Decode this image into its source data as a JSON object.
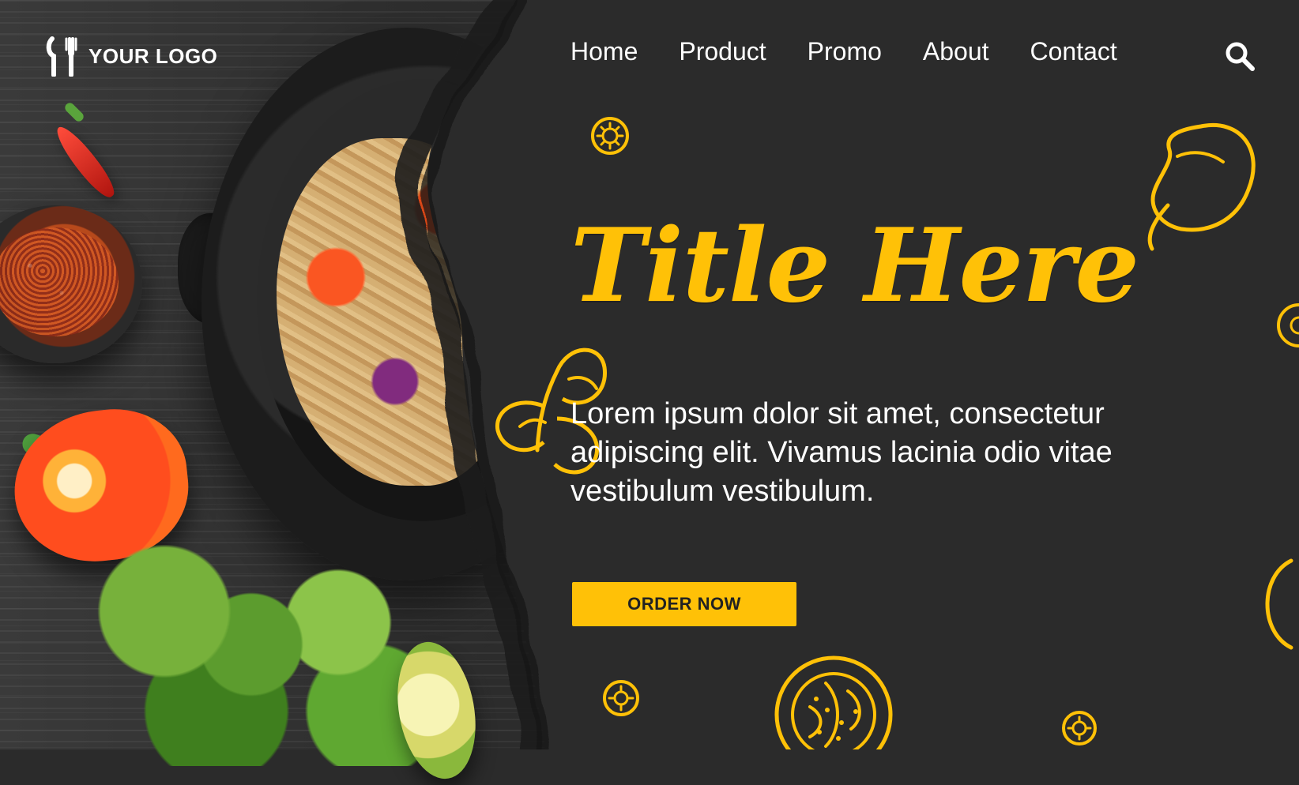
{
  "brand": {
    "logo_text": "YOUR LOGO",
    "colors": {
      "accent": "#ffc107",
      "panel": "#2b2b2b",
      "text": "#ffffff"
    }
  },
  "nav": {
    "items": [
      {
        "label": "Home"
      },
      {
        "label": "Product"
      },
      {
        "label": "Promo"
      },
      {
        "label": "About"
      },
      {
        "label": "Contact"
      }
    ],
    "search_icon": "search-icon"
  },
  "hero": {
    "title": "Title Here",
    "body": "Lorem ipsum dolor sit amet, consectetur adipiscing elit. Vivamus lacinia odio vitae vestibulum vestibulum.",
    "cta_label": "ORDER NOW"
  },
  "icons": {
    "decorative": [
      "sun-doodle-icon",
      "pepper-doodle-icon",
      "parsley-doodle-icon",
      "tomato-doodle-icon"
    ]
  }
}
